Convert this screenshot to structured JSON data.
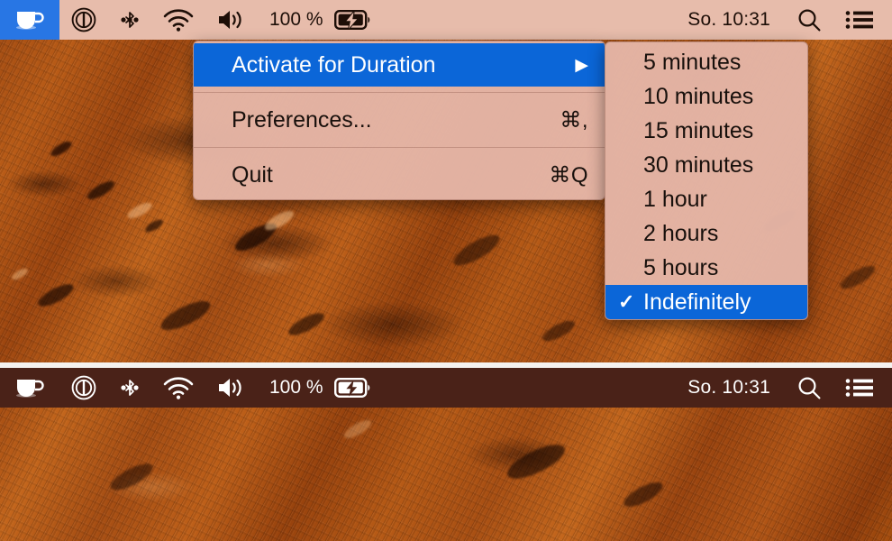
{
  "desktop": {
    "wallpaper_description": "mars-like rusty orange terrain"
  },
  "menubar_top": {
    "app_icon": "coffee-cup-icon",
    "status_items": [
      {
        "id": "power-icon",
        "label": ""
      },
      {
        "id": "bluetooth-icon",
        "label": ""
      },
      {
        "id": "wifi-icon",
        "label": ""
      },
      {
        "id": "volume-icon",
        "label": ""
      }
    ],
    "battery_percent": "100 %",
    "battery_icon": "battery-charging-icon",
    "clock": "So. 10:31",
    "search_icon": "search-icon",
    "control_center_icon": "list-menu-icon"
  },
  "menubar_bottom": {
    "app_icon": "coffee-cup-icon",
    "battery_percent": "100 %",
    "clock": "So. 10:31",
    "search_icon": "search-icon",
    "control_center_icon": "list-menu-icon"
  },
  "menu_main": {
    "items": [
      {
        "label": "Activate for Duration",
        "shortcut": "",
        "arrow": "▶",
        "selected": true,
        "separator_after": true
      },
      {
        "label": "Preferences...",
        "shortcut": "⌘,",
        "arrow": "",
        "selected": false,
        "separator_after": true
      },
      {
        "label": "Quit",
        "shortcut": "⌘Q",
        "arrow": "",
        "selected": false,
        "separator_after": false
      }
    ]
  },
  "menu_sub": {
    "items": [
      {
        "label": "5 minutes",
        "checked": false,
        "selected": false
      },
      {
        "label": "10 minutes",
        "checked": false,
        "selected": false
      },
      {
        "label": "15 minutes",
        "checked": false,
        "selected": false
      },
      {
        "label": "30 minutes",
        "checked": false,
        "selected": false
      },
      {
        "label": "1 hour",
        "checked": false,
        "selected": false
      },
      {
        "label": "2 hours",
        "checked": false,
        "selected": false
      },
      {
        "label": "5 hours",
        "checked": false,
        "selected": false
      },
      {
        "label": "Indefinitely",
        "checked": true,
        "selected": true,
        "check_glyph": "✓"
      }
    ]
  },
  "colors": {
    "menubar_top_bg": "#e7bcab",
    "menubar_bottom_bg": "#4a2218",
    "highlight_blue": "#0b66d8",
    "app_active_blue": "#2876e4",
    "menu_bg": "#e4b5a6",
    "text_dark": "#18100c",
    "text_light": "#ffffff"
  }
}
